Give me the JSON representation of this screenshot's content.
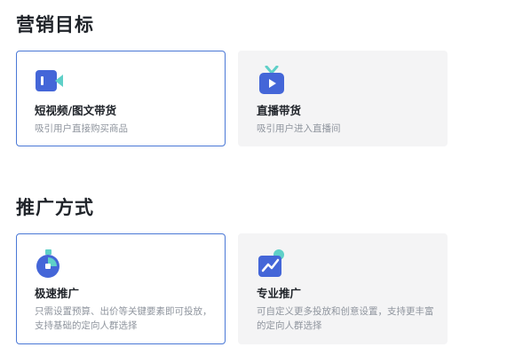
{
  "sections": {
    "goal": {
      "title": "营销目标",
      "cards": [
        {
          "title": "短视频/图文带货",
          "desc": "吸引用户直接购买商品",
          "icon": "video-camera-icon",
          "selected": true
        },
        {
          "title": "直播带货",
          "desc": "吸引用户进入直播间",
          "icon": "tv-icon",
          "selected": false
        }
      ]
    },
    "mode": {
      "title": "推广方式",
      "cards": [
        {
          "title": "极速推广",
          "desc": "只需设置预算、出价等关键要素即可投放，支持基础的定向人群选择",
          "icon": "stopwatch-icon",
          "selected": true
        },
        {
          "title": "专业推广",
          "desc": "可自定义更多投放和创意设置，支持更丰富的定向人群选择",
          "icon": "trend-chart-icon",
          "selected": false
        }
      ]
    }
  },
  "colors": {
    "accent": "#4a78d6",
    "icon_blue": "#4466d8",
    "icon_teal": "#5fd0c8",
    "card_bg": "#f4f4f5"
  }
}
